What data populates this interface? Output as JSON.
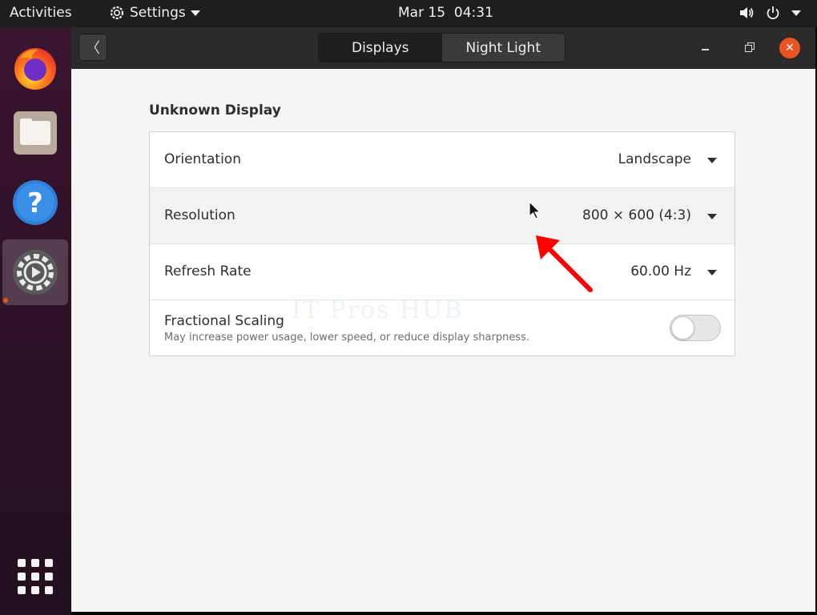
{
  "topbar": {
    "activities": "Activities",
    "app_menu": "Settings",
    "clock": "Mar 15  04:31",
    "icons": [
      "settings-gear-icon",
      "volume-icon",
      "power-icon",
      "chevron-down-icon"
    ]
  },
  "dock": {
    "items": [
      {
        "name": "firefox",
        "icon": "firefox-icon"
      },
      {
        "name": "files",
        "icon": "files-icon"
      },
      {
        "name": "help",
        "icon": "help-icon",
        "glyph": "?"
      },
      {
        "name": "settings",
        "icon": "settings-icon",
        "active": true
      }
    ],
    "show_apps_icon": "grid-icon"
  },
  "window": {
    "back_glyph": "〈",
    "tabs": [
      {
        "label": "Displays",
        "selected": true
      },
      {
        "label": "Night Light",
        "selected": false
      }
    ],
    "close_glyph": "✕"
  },
  "display": {
    "title": "Unknown Display",
    "rows": [
      {
        "label": "Orientation",
        "value": "Landscape"
      },
      {
        "label": "Resolution",
        "value": "800 × 600 (4:3)"
      },
      {
        "label": "Refresh Rate",
        "value": "60.00 Hz"
      }
    ],
    "fractional_scaling": {
      "label": "Fractional Scaling",
      "description": "May increase power usage, lower speed, or reduce display sharpness.",
      "enabled": false
    }
  },
  "watermark": "IT Pros HUB",
  "colors": {
    "accent": "#e95420",
    "annotation": "#ff0000",
    "headerbar": "#2b2b2b",
    "content_bg": "#f6f5f4"
  }
}
